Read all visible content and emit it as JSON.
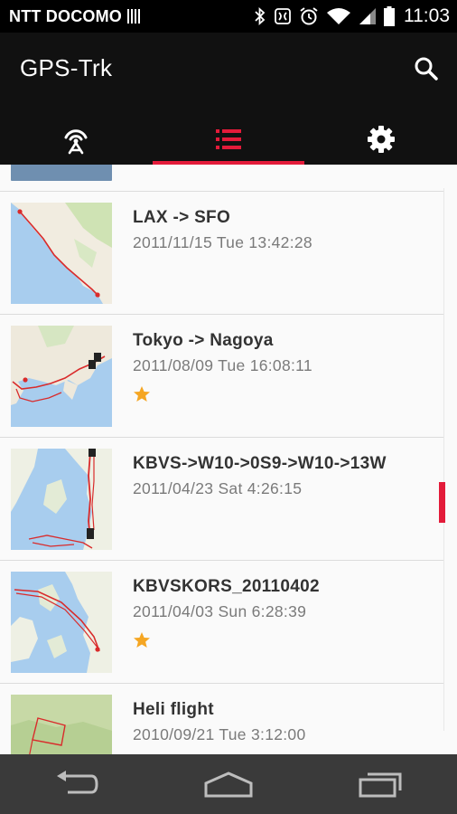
{
  "status_bar": {
    "carrier": "NTT DOCOMO",
    "time": "11:03",
    "icons": [
      "barcode-icon",
      "bluetooth-icon",
      "nfc-icon",
      "alarm-icon",
      "wifi-icon",
      "signal-icon",
      "battery-icon"
    ]
  },
  "app_bar": {
    "title": "GPS-Trk",
    "search_icon": "search-icon"
  },
  "tabs": [
    {
      "icon": "gps-signal-icon",
      "active": false
    },
    {
      "icon": "list-icon",
      "active": true
    },
    {
      "icon": "gear-icon",
      "active": false
    }
  ],
  "tracks": [
    {
      "title": "LAX -> SFO",
      "date": "2011/11/15 Tue  13:42:28",
      "starred": false
    },
    {
      "title": "Tokyo -> Nagoya",
      "date": "2011/08/09 Tue  16:08:11",
      "starred": true
    },
    {
      "title": "KBVS->W10->0S9->W10->13W",
      "date": "2011/04/23 Sat  4:26:15",
      "starred": false
    },
    {
      "title": "KBVSKORS_20110402",
      "date": "2011/04/03 Sun  6:28:39",
      "starred": true
    },
    {
      "title": "Heli flight",
      "date": "2010/09/21 Tue  3:12:00",
      "starred": false
    }
  ],
  "nav_bar": [
    "back-icon",
    "home-icon",
    "recents-icon"
  ],
  "colors": {
    "accent": "#e31b3a",
    "star": "#f5a623",
    "toolbar": "#111111",
    "navbar": "#3a3a3a"
  }
}
